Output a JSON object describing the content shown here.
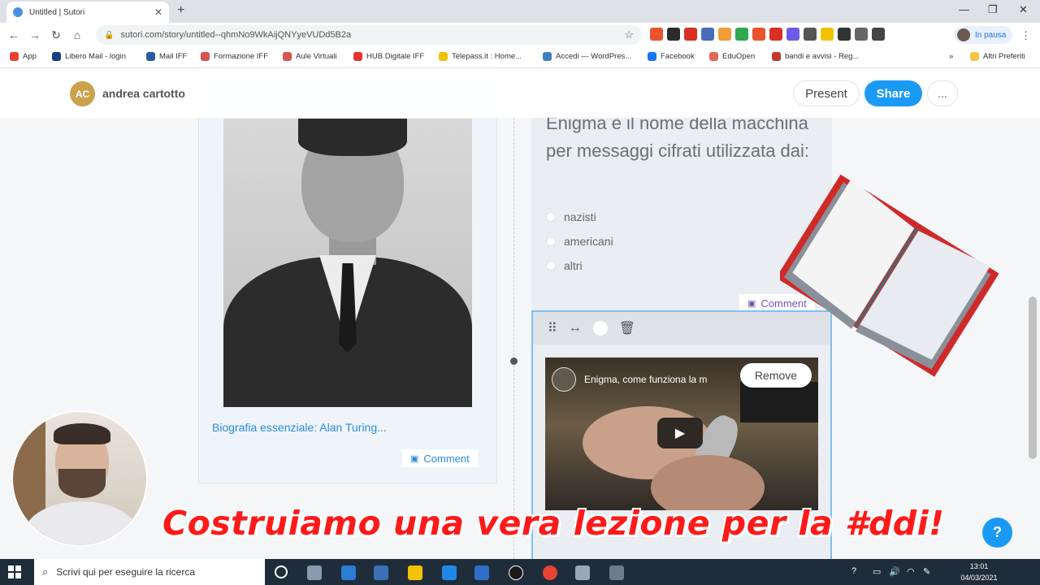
{
  "browser": {
    "tab_title": "Untitled | Sutori",
    "tab_close": "✕",
    "new_tab": "+",
    "window_controls": {
      "minimize": "—",
      "maximize": "❐",
      "close": "✕"
    },
    "nav": {
      "back": "←",
      "forward": "→",
      "reload": "↻",
      "home": "⌂"
    },
    "url": "sutori.com/story/untitled--qhmNo9WkAijQNYyeVUDd5B2a",
    "lock": "🔒",
    "bookmark_star": "☆",
    "profile_status": "In pausa",
    "menu": "⋮",
    "extension_icons": [
      "new-extension-icon",
      "extension-icon",
      "gmail-icon",
      "extension-icon",
      "extension-icon",
      "extension-icon",
      "extension-icon",
      "extension-icon",
      "settings-extension-icon",
      "extension-icon",
      "thumbs-up-icon",
      "grid-icon",
      "window-icon",
      "puzzle-icon"
    ]
  },
  "bookmarks": {
    "items": [
      {
        "label": "App",
        "color": "#e94235"
      },
      {
        "label": "Libero Mail - login",
        "color": "#1a3d7c"
      },
      {
        "label": "Mail IFF",
        "color": "#2a5d9f"
      },
      {
        "label": "Formazione IFF",
        "color": "#d9534f"
      },
      {
        "label": "Aule Virtuali",
        "color": "#d9534f"
      },
      {
        "label": "HUB Digitale IFF",
        "color": "#e3342f"
      },
      {
        "label": "Telepass.it : Home...",
        "color": "#f2c200"
      },
      {
        "label": "Accedi — WordPres...",
        "color": "#3c7ebf"
      },
      {
        "label": "Facebook",
        "color": "#1877f2"
      },
      {
        "label": "EduOpen",
        "color": "#e06a5a"
      },
      {
        "label": "bandi e avvisi - Reg...",
        "color": "#c0392b"
      }
    ],
    "overflow": "»",
    "other_label": "Altri Preferiti"
  },
  "app": {
    "avatar_initials": "AC",
    "user_name": "andrea cartotto",
    "present_label": "Present",
    "share_label": "Share",
    "more_label": "...",
    "left_card": {
      "caption": "Biografia essenziale: Alan Turing...",
      "comment_label": "Comment"
    },
    "quiz": {
      "question": "Enigma è il nome della macchina per messaggi cifrati utilizzata dai:",
      "options": [
        "nazisti",
        "americani",
        "altri"
      ],
      "comment_label": "Comment"
    },
    "video_card": {
      "tools": {
        "drag": "⠿",
        "resize": "↔",
        "delete": "🗑"
      },
      "video_title": "Enigma, come funziona la m",
      "play": "▶",
      "remove_label": "Remove"
    },
    "help": "?"
  },
  "overlay_title": "Costruiamo una vera lezione per la #ddi!",
  "taskbar": {
    "search_placeholder": "Scrivi qui per eseguire la ricerca",
    "search_icon": "⌕",
    "time": "13:01",
    "date": "04/03/2021",
    "tray_icons": [
      "help-icon",
      "battery-icon",
      "volume-icon",
      "wifi-icon",
      "pen-icon"
    ],
    "tray_symbols": [
      "?",
      "▭",
      "🔊",
      "◠",
      "✎"
    ]
  }
}
